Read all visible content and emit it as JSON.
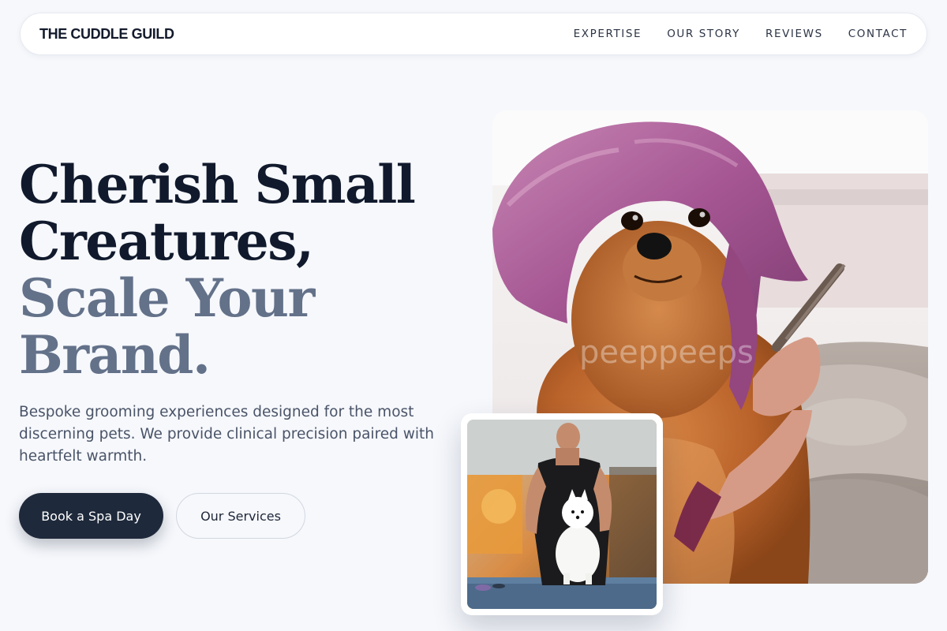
{
  "nav": {
    "brand": "THE CUDDLE GUILD",
    "links": [
      "EXPERTISE",
      "OUR STORY",
      "REVIEWS",
      "CONTACT"
    ]
  },
  "hero": {
    "headline_dark_1": "Cherish Small",
    "headline_dark_2": "Creatures,",
    "headline_muted_1": "Scale Your",
    "headline_muted_2": "Brand.",
    "lede": "Bespoke grooming experiences designed for the most discerning pets. We provide clinical precision paired with heartfelt warmth.",
    "primary_cta": "Book a Spa Day",
    "secondary_cta": "Our Services"
  },
  "images": {
    "main": "pomeranian-with-pink-towel-photo",
    "inset": "groomer-combing-white-spitz-photo",
    "watermark": "peeppeeps"
  },
  "colors": {
    "background": "#f6f8fc",
    "headline_dark": "#111a2d",
    "headline_muted": "#637189",
    "primary_button": "#1e293b"
  }
}
